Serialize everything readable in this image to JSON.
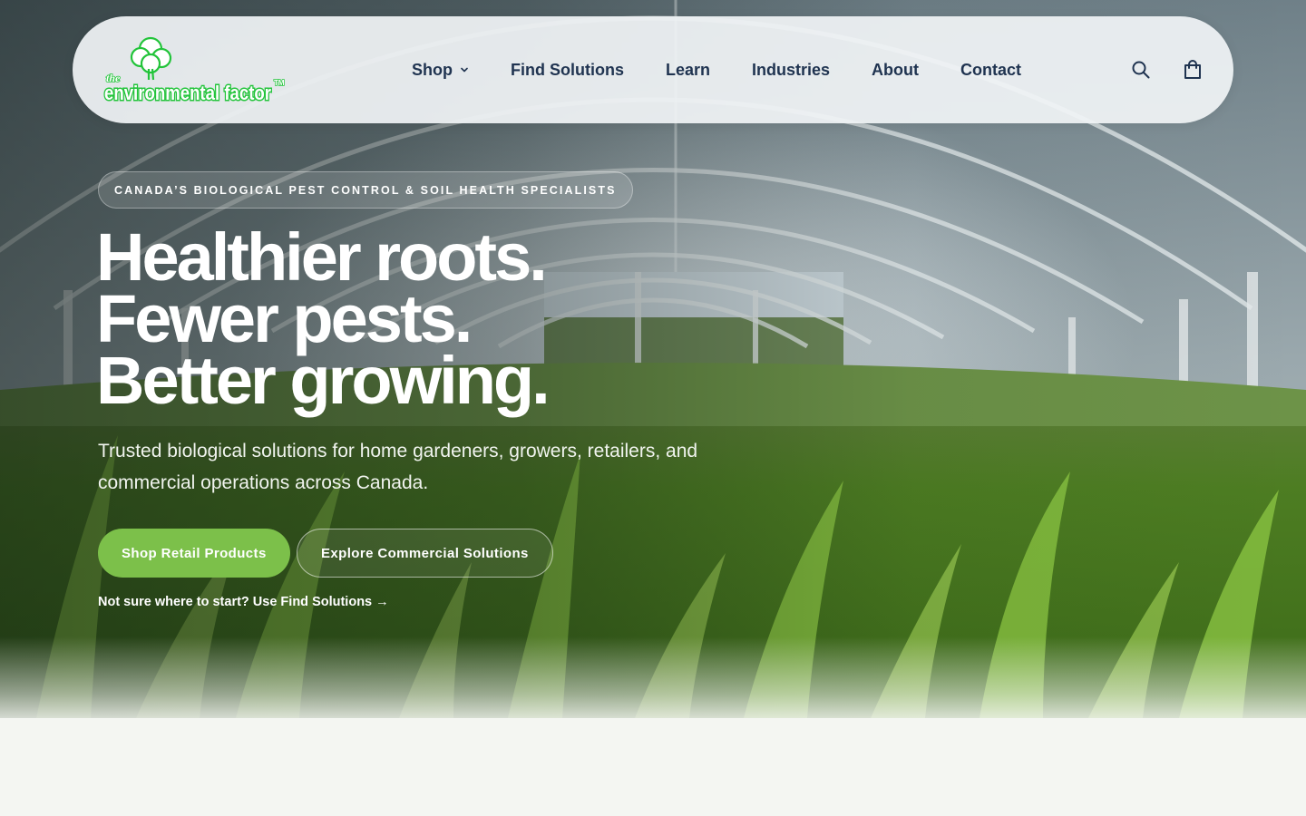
{
  "brand": {
    "logo_text_top": "the",
    "logo_text_main": "environmental factor",
    "logo_text_tm": "TM",
    "color": "#22c43a"
  },
  "nav": {
    "items": [
      {
        "label": "Shop",
        "has_dropdown": true
      },
      {
        "label": "Find Solutions"
      },
      {
        "label": "Learn"
      },
      {
        "label": "Industries"
      },
      {
        "label": "About"
      },
      {
        "label": "Contact"
      }
    ],
    "icons": [
      "search-icon",
      "shopping-bag-icon"
    ],
    "text_color": "#1f3350"
  },
  "hero": {
    "eyebrow": "CANADA’S BIOLOGICAL PEST CONTROL & SOIL HEALTH SPECIALISTS",
    "headline": [
      "Healthier roots.",
      "Fewer pests.",
      "Better growing."
    ],
    "subheading": "Trusted biological solutions for home gardeners, growers, retailers, and commercial operations across Canada.",
    "primary_cta": "Shop Retail Products",
    "secondary_cta": "Explore Commercial Solutions",
    "helper_link": "Not sure where to start? Use Find Solutions →",
    "accent_color": "#7cc04a"
  }
}
